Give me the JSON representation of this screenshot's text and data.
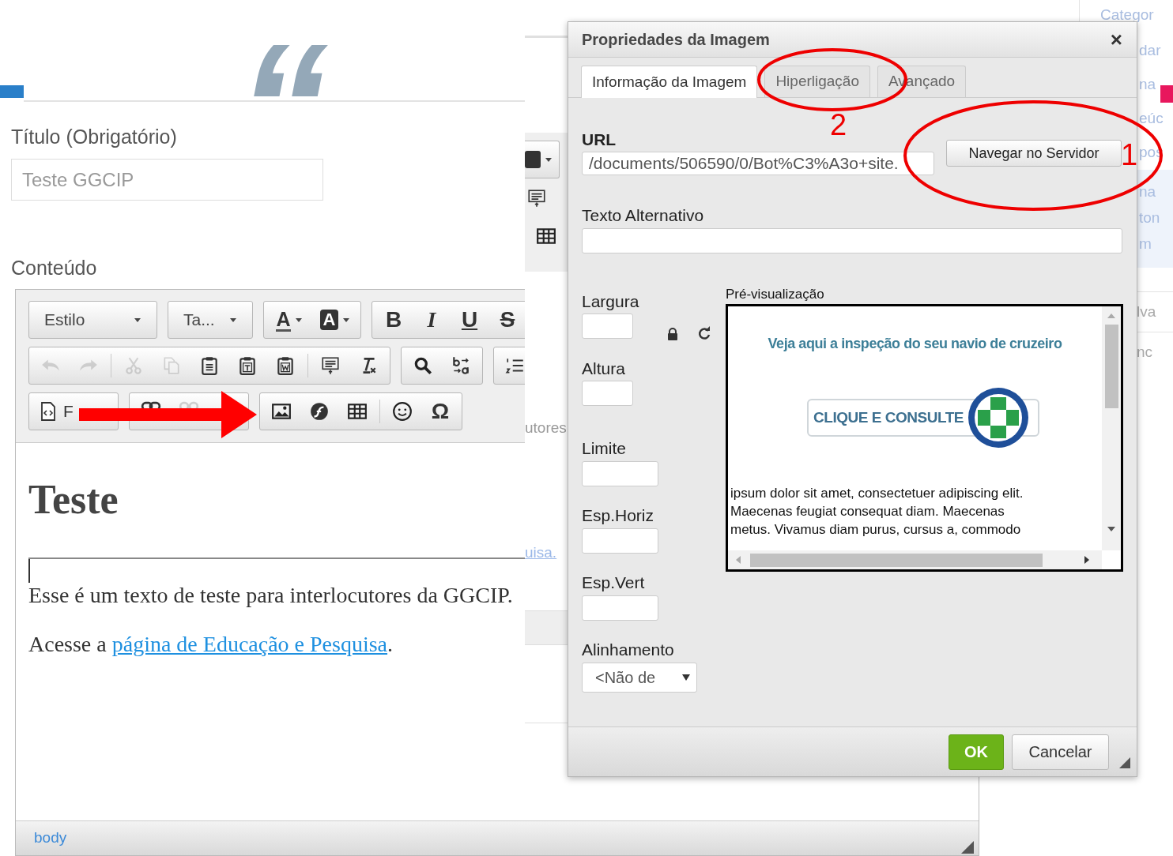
{
  "page": {
    "quote_mark": "“",
    "title_label": "Título (Obrigatório)",
    "title_value": "Teste GGCIP",
    "content_label": "Conteúdo"
  },
  "toolbar": [
    [
      [
        {
          "kind": "combo",
          "label": "Estilo"
        }
      ],
      [
        {
          "kind": "combo",
          "label": "Ta..."
        }
      ],
      [
        {
          "kind": "text_color",
          "label": "A"
        },
        {
          "kind": "bg_color",
          "label": "A"
        }
      ],
      [
        {
          "kind": "bold",
          "label": "B"
        },
        {
          "kind": "italic",
          "label": "I"
        },
        {
          "kind": "underline",
          "label": "U"
        },
        {
          "kind": "strike",
          "label": "S"
        }
      ]
    ],
    [
      [
        {
          "kind": "icon",
          "disabled": true
        },
        {
          "kind": "icon",
          "disabled": true
        },
        {
          "kind": "separator"
        },
        {
          "kind": "icon",
          "disabled": true
        },
        {
          "kind": "icon",
          "disabled": true
        },
        {
          "kind": "icon",
          "disabled": false
        },
        {
          "kind": "icon",
          "disabled": false
        },
        {
          "kind": "icon",
          "disabled": false
        },
        {
          "kind": "separator"
        },
        {
          "kind": "icon",
          "disabled": false
        },
        {
          "kind": "icon",
          "disabled": false
        }
      ],
      [
        {
          "kind": "icon",
          "disabled": false
        },
        {
          "kind": "icon",
          "disabled": false
        }
      ],
      [
        {
          "kind": "icon",
          "disabled": false
        }
      ]
    ],
    [
      [
        {
          "kind": "source",
          "label": "F"
        }
      ],
      [
        {
          "kind": "icon",
          "disabled": false
        },
        {
          "kind": "icon",
          "disabled": true
        }
      ],
      [
        {
          "kind": "icon",
          "disabled": false
        },
        {
          "kind": "icon",
          "disabled": false
        },
        {
          "kind": "icon",
          "disabled": false
        },
        {
          "kind": "separator"
        },
        {
          "kind": "icon",
          "disabled": false
        },
        {
          "kind": "glyph",
          "label": "Ω"
        }
      ]
    ]
  ],
  "editor": {
    "heading": "Teste",
    "paragraph": "Esse é um texto de teste para interlocutores da GGCIP.",
    "link_sentence": {
      "before": "Acesse a ",
      "link": "página de Educação e Pesquisa",
      "after": "."
    },
    "path": "body"
  },
  "behind_left": {
    "text": "utores",
    "link": "uisa."
  },
  "behind_right": {
    "top_link": "Categor",
    "links": [
      "dar",
      "na",
      "eúc",
      "pos"
    ],
    "panel_links": [
      "na",
      "ton",
      "m"
    ],
    "items": [
      "lva",
      "nc"
    ]
  },
  "dialog": {
    "title": "Propriedades da Imagem",
    "close": "×",
    "tabs": [
      {
        "label": "Informação da Imagem",
        "selected": true
      },
      {
        "label": "Hiperligação",
        "selected": false
      },
      {
        "label": "Avançado",
        "selected": false
      }
    ],
    "url_label": "URL",
    "url_value": "/documents/506590/0/Bot%C3%A3o+site.",
    "browse_button": "Navegar no Servidor",
    "alt_label": "Texto Alternativo",
    "size_fields": [
      {
        "label": "Largura"
      },
      {
        "label": "Altura"
      }
    ],
    "spacing_fields": [
      {
        "label": "Limite"
      },
      {
        "label": "Esp.Horiz"
      },
      {
        "label": "Esp.Vert"
      }
    ],
    "align_label": "Alinhamento",
    "align_value": "<Não de",
    "preview_label": "Pré-visualização",
    "preview": {
      "banner_heading": "Veja aqui a inspeção do seu navio de cruzeiro",
      "banner_button": "CLIQUE E CONSULTE",
      "lines": [
        "ipsum dolor sit amet, consectetuer adipiscing elit.",
        "Maecenas feugiat consequat diam. Maecenas",
        "metus. Vivamus diam purus, cursus a, commodo"
      ]
    },
    "ok": "OK",
    "cancel": "Cancelar"
  },
  "annotations": [
    {
      "kind": "arrow"
    },
    {
      "kind": "circle",
      "label": "2"
    },
    {
      "kind": "circle",
      "label": "1"
    }
  ]
}
